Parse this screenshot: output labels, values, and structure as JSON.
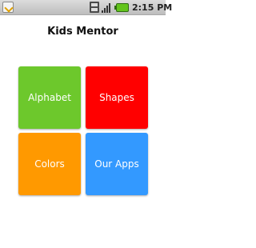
{
  "status_bar": {
    "time": "2:15 PM",
    "icons": [
      "notification-icon",
      "network-icon",
      "signal-icon",
      "battery-icon"
    ]
  },
  "app": {
    "title": "Kids Mentor"
  },
  "tiles": [
    {
      "label": "Alphabet",
      "color": "#6dc82c"
    },
    {
      "label": "Shapes",
      "color": "#ff0000"
    },
    {
      "label": "Colors",
      "color": "#ff9900"
    },
    {
      "label": "Our Apps",
      "color": "#3399ff"
    }
  ]
}
